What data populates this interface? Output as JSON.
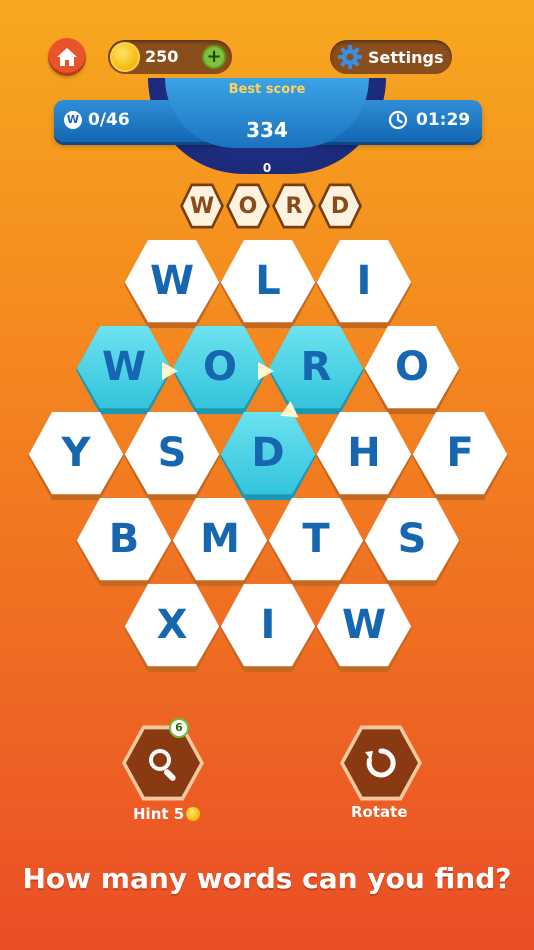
{
  "header": {
    "coins": "250",
    "plus": "+",
    "settings_label": "Settings"
  },
  "score": {
    "best_label": "Best score",
    "best_value": "334",
    "current": "0",
    "progress_badge": "W",
    "progress": "0/46",
    "timer": "01:29"
  },
  "current_word": [
    "W",
    "O",
    "R",
    "D"
  ],
  "grid": {
    "rows": [
      [
        "W",
        "L",
        "I"
      ],
      [
        "W",
        "O",
        "R",
        "O"
      ],
      [
        "Y",
        "S",
        "D",
        "H",
        "F"
      ],
      [
        "B",
        "M",
        "T",
        "S"
      ],
      [
        "X",
        "I",
        "W"
      ]
    ],
    "selected": [
      [
        1,
        0
      ],
      [
        1,
        1
      ],
      [
        1,
        2
      ],
      [
        2,
        2
      ]
    ]
  },
  "buttons": {
    "hint_label": "Hint 5",
    "hint_count": "6",
    "rotate_label": "Rotate"
  },
  "footer": {
    "prompt": "How many words can you find?"
  },
  "colors": {
    "letter": "#1666b0",
    "selected_tile": "#32c3dc",
    "background_top": "#f7a81f",
    "background_bottom": "#ea4e27"
  }
}
